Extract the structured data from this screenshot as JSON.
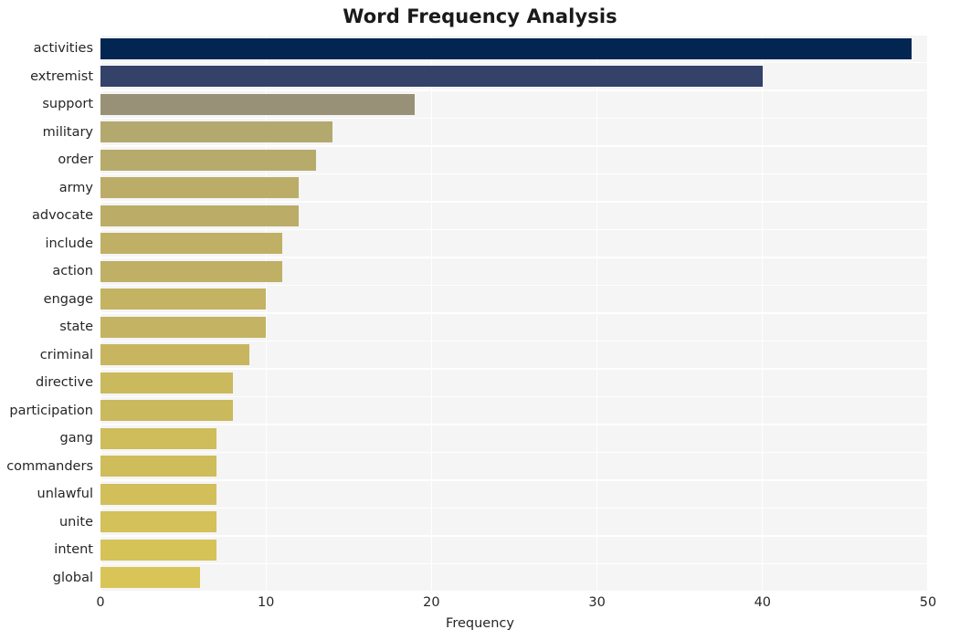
{
  "chart_data": {
    "type": "bar",
    "orientation": "horizontal",
    "title": "Word Frequency Analysis",
    "xlabel": "Frequency",
    "ylabel": "",
    "xlim": [
      0,
      50
    ],
    "xticks": [
      0,
      10,
      20,
      30,
      40,
      50
    ],
    "grid": true,
    "legend": false,
    "categories": [
      "activities",
      "extremist",
      "support",
      "military",
      "order",
      "army",
      "advocate",
      "include",
      "action",
      "engage",
      "state",
      "criminal",
      "directive",
      "participation",
      "gang",
      "commanders",
      "unlawful",
      "unite",
      "intent",
      "global"
    ],
    "values": [
      49,
      40,
      19,
      14,
      13,
      12,
      12,
      11,
      11,
      10,
      10,
      9,
      8,
      8,
      7,
      7,
      7,
      7,
      7,
      6
    ],
    "bar_colors": [
      "#032551",
      "#344169",
      "#999177",
      "#b3a96f",
      "#b7ab6b",
      "#bbad68",
      "#bbad68",
      "#bfb065",
      "#bfb065",
      "#c3b362",
      "#c3b362",
      "#c7b65f",
      "#cbb95d",
      "#cbb95d",
      "#cfbc5b",
      "#cfbc5b",
      "#d2bf5a",
      "#d4c159",
      "#d6c358",
      "#d9c557"
    ],
    "plot_background": "#f5f5f6",
    "gridline_color": "#ffffff",
    "text_color": "#262626",
    "title_color": "#1a1a1a"
  }
}
